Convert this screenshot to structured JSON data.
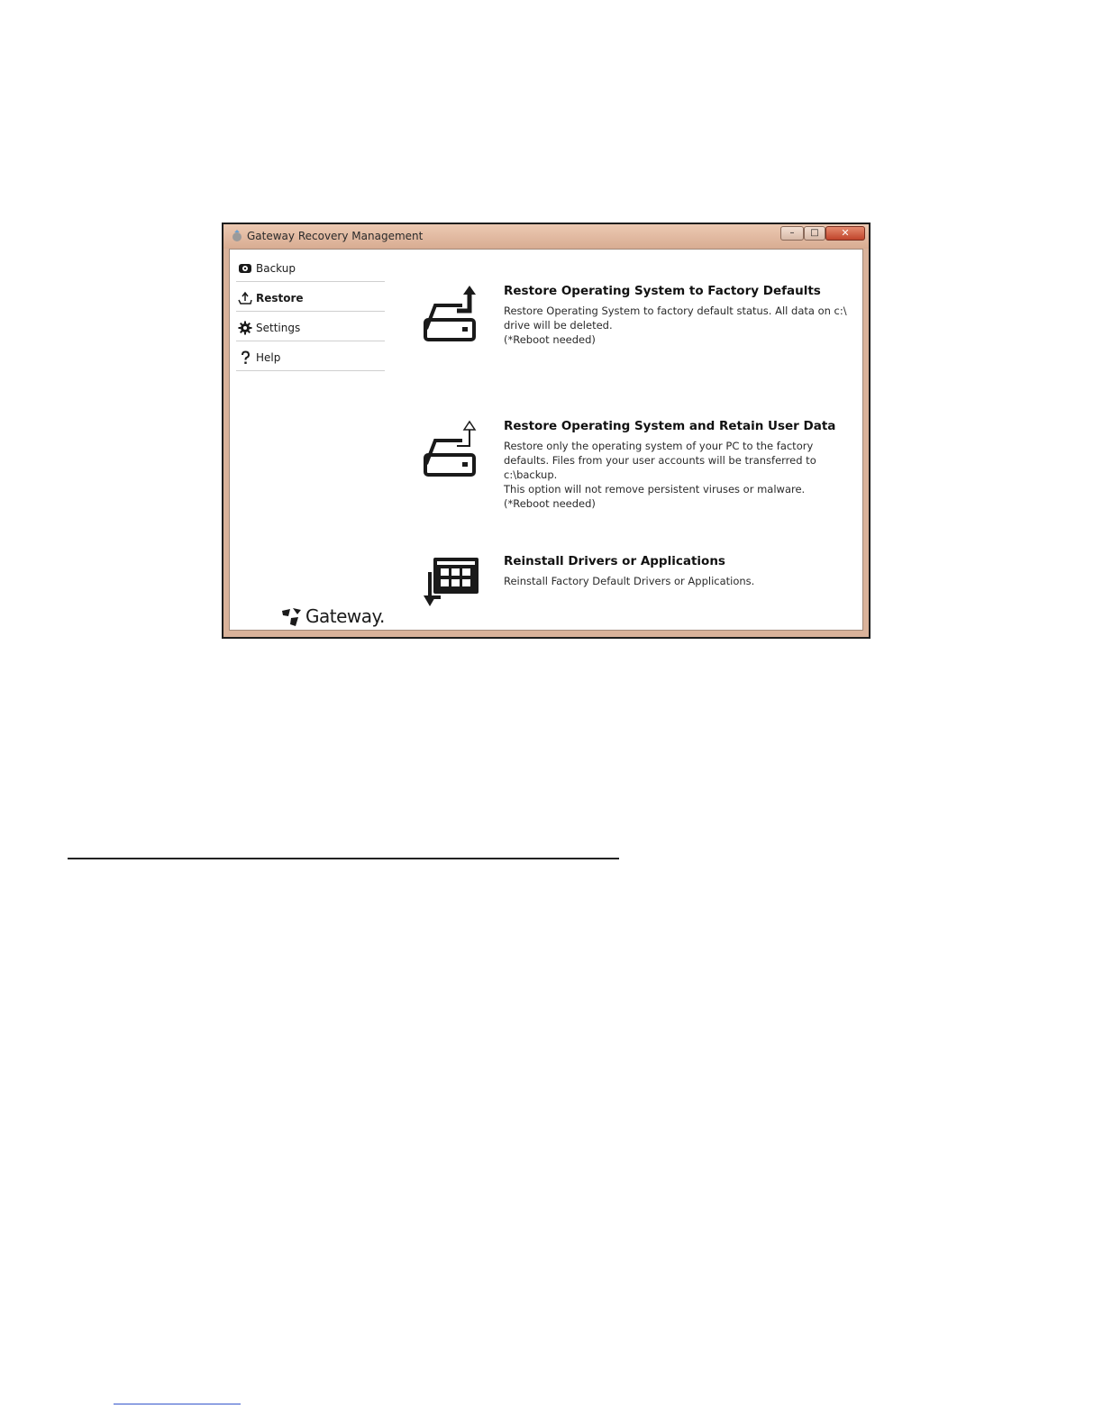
{
  "window": {
    "title": "Gateway Recovery Management",
    "controls": {
      "minimize": "–",
      "maximize": "□",
      "close": "✕"
    }
  },
  "sidebar": {
    "items": [
      {
        "label": "Backup",
        "icon": "disc-icon",
        "active": false
      },
      {
        "label": "Restore",
        "icon": "restore-upload-icon",
        "active": true
      },
      {
        "label": "Settings",
        "icon": "gear-icon",
        "active": false
      },
      {
        "label": "Help",
        "icon": "question-icon",
        "active": false
      }
    ]
  },
  "options": [
    {
      "title": "Restore Operating System to Factory Defaults",
      "desc": [
        "Restore Operating System to factory default status. All data on c:\\",
        "drive will be deleted.",
        "(*Reboot needed)"
      ],
      "icon": "drive-upload-icon"
    },
    {
      "title": "Restore Operating System and Retain User Data",
      "desc": [
        "Restore only the operating system of your PC to the factory",
        "defaults. Files from your user accounts will be transferred to",
        "c:\\backup.",
        "This option will not remove persistent viruses or malware.",
        "(*Reboot needed)"
      ],
      "icon": "drive-upload-outline-icon"
    },
    {
      "title": "Reinstall Drivers or Applications",
      "desc": [
        "Reinstall Factory Default Drivers or Applications."
      ],
      "icon": "apps-grid-download-icon"
    }
  ],
  "brand": {
    "name": "Gateway."
  },
  "colors": {
    "titlebar": "#d8ac92",
    "close_button": "#c0452c",
    "frame": "#1e1e1e"
  }
}
